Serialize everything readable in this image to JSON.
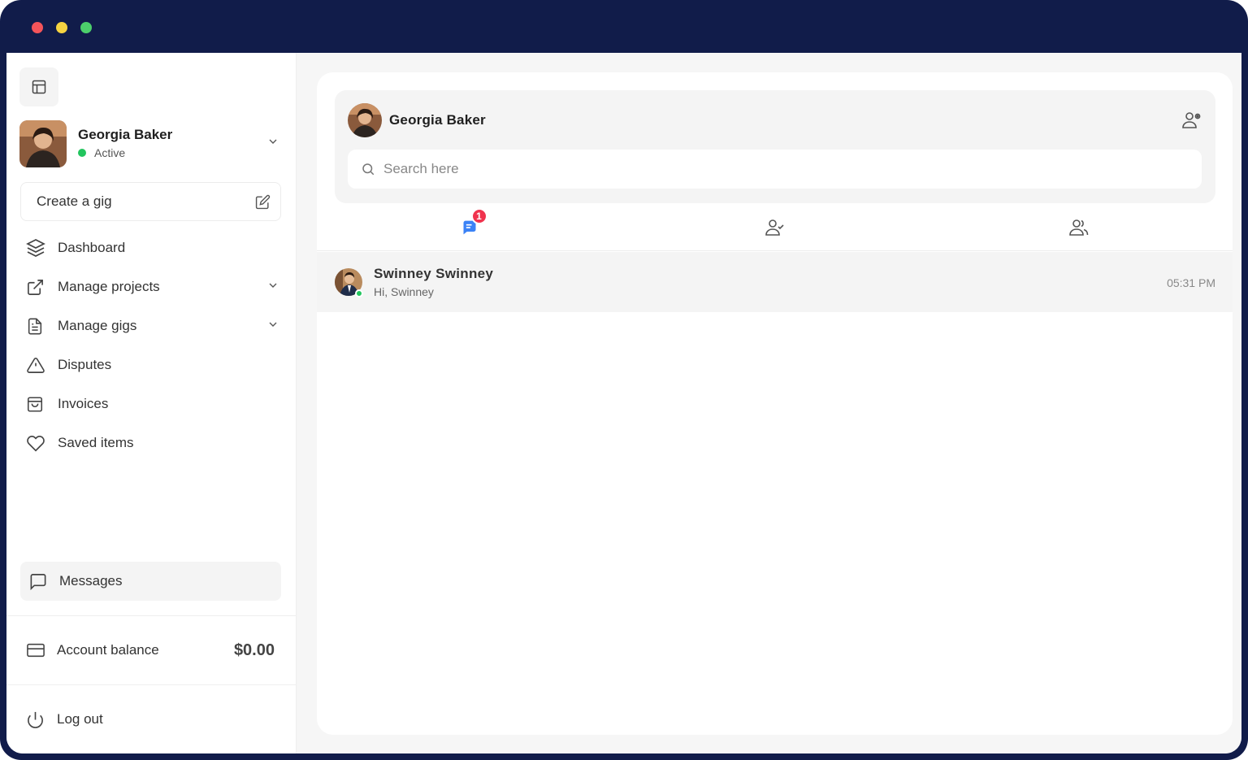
{
  "window": {
    "controls": [
      "close",
      "minimize",
      "maximize"
    ]
  },
  "sidebar": {
    "user": {
      "name": "Georgia Baker",
      "status": "Active"
    },
    "create_gig_label": "Create a gig",
    "nav": [
      {
        "label": "Dashboard",
        "icon": "layers-icon"
      },
      {
        "label": "Manage projects",
        "icon": "external-link-icon",
        "expandable": true
      },
      {
        "label": "Manage gigs",
        "icon": "document-icon",
        "expandable": true
      },
      {
        "label": "Disputes",
        "icon": "warning-icon"
      },
      {
        "label": "Invoices",
        "icon": "bag-icon"
      },
      {
        "label": "Saved items",
        "icon": "heart-icon"
      }
    ],
    "messages_label": "Messages",
    "account_balance": {
      "label": "Account balance",
      "value": "$0.00"
    },
    "logout_label": "Log out"
  },
  "chat": {
    "header_name": "Georgia Baker",
    "search_placeholder": "Search here",
    "tabs": [
      {
        "icon": "chat-icon",
        "badge": "1",
        "color": "#3b82f6"
      },
      {
        "icon": "user-check-icon"
      },
      {
        "icon": "users-icon"
      }
    ],
    "conversations": [
      {
        "name": "Swinney Swinney",
        "preview": "Hi, Swinney",
        "time": "05:31 PM",
        "online": true
      }
    ]
  },
  "colors": {
    "frame": "#111c4a",
    "accent": "#3b82f6",
    "badge": "#f0334e",
    "online": "#22c55e"
  }
}
